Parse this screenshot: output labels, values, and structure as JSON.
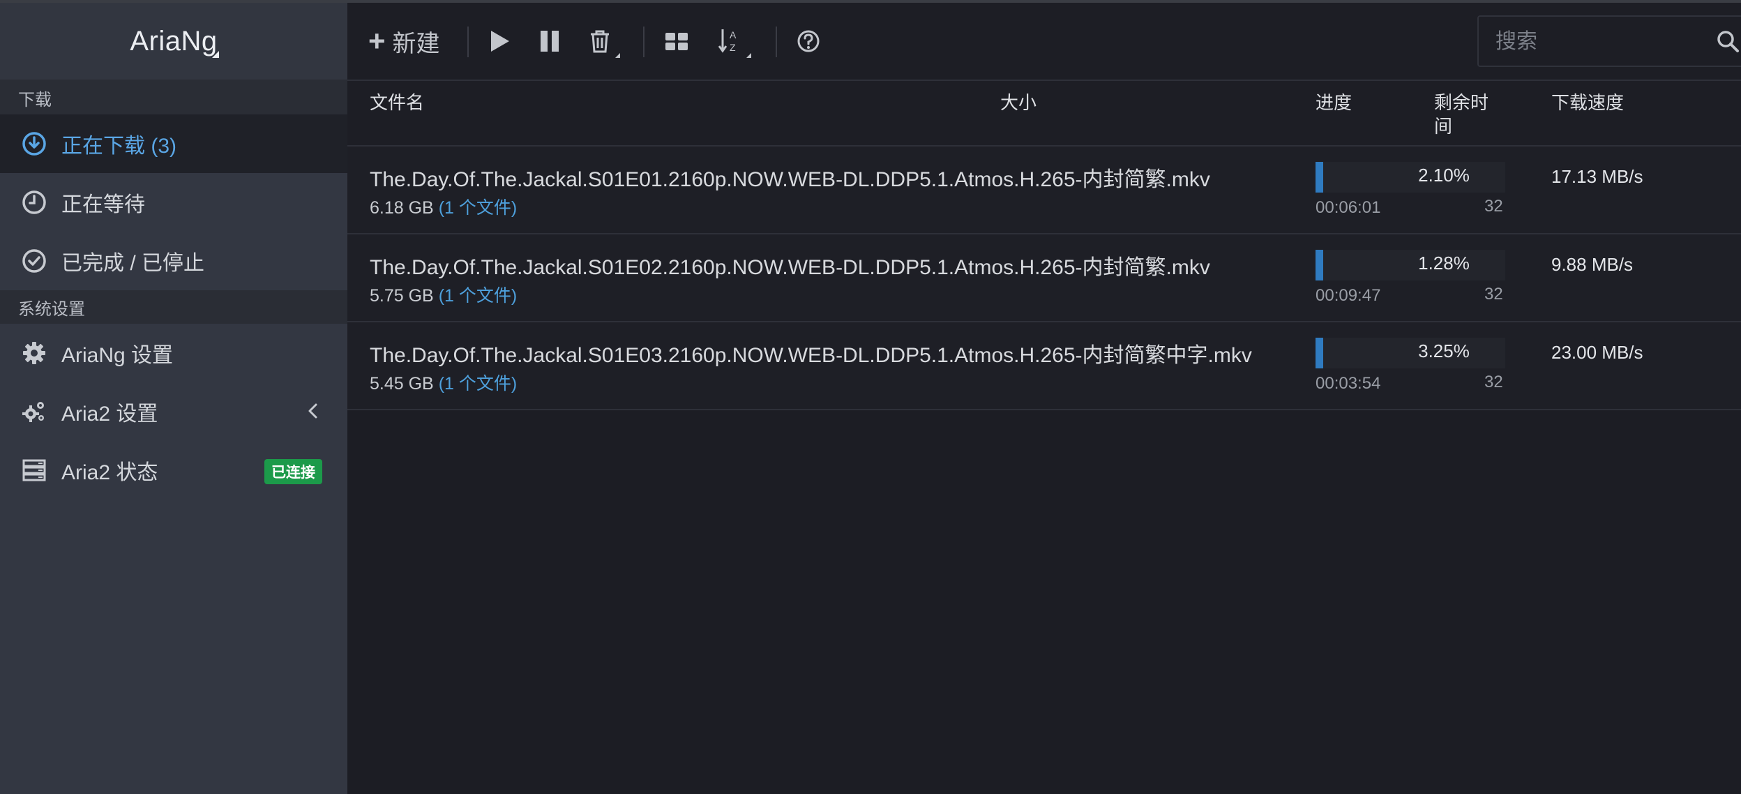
{
  "brand": {
    "name": "AriaNg"
  },
  "sidebar": {
    "download_header": "下载",
    "items": [
      {
        "label": "正在下载 (3)",
        "icon": "download-circle-icon",
        "active": true
      },
      {
        "label": "正在等待",
        "icon": "clock-icon"
      },
      {
        "label": "已完成 / 已停止",
        "icon": "check-circle-icon"
      }
    ],
    "settings_header": "系统设置",
    "settings_items": [
      {
        "label": "AriaNg 设置",
        "icon": "gear-icon"
      },
      {
        "label": "Aria2 设置",
        "icon": "gears-icon"
      },
      {
        "label": "Aria2 状态",
        "icon": "server-icon",
        "badge": "已连接"
      }
    ]
  },
  "toolbar": {
    "new_label": "新建",
    "search_placeholder": "搜索"
  },
  "table": {
    "headers": {
      "name": "文件名",
      "size": "大小",
      "progress": "进度",
      "remaining": "剩余时间",
      "speed": "下载速度"
    },
    "rows": [
      {
        "name": "The.Day.Of.The.Jackal.S01E01.2160p.NOW.WEB-DL.DDP5.1.Atmos.H.265-内封简繁.mkv",
        "size": "6.18 GB",
        "files": "(1 个文件)",
        "progress": 2.1,
        "progress_text": "2.10%",
        "eta": "00:06:01",
        "connections": "32",
        "speed": "17.13 MB/s"
      },
      {
        "name": "The.Day.Of.The.Jackal.S01E02.2160p.NOW.WEB-DL.DDP5.1.Atmos.H.265-内封简繁.mkv",
        "size": "5.75 GB",
        "files": "(1 个文件)",
        "progress": 1.28,
        "progress_text": "1.28%",
        "eta": "00:09:47",
        "connections": "32",
        "speed": "9.88 MB/s"
      },
      {
        "name": "The.Day.Of.The.Jackal.S01E03.2160p.NOW.WEB-DL.DDP5.1.Atmos.H.265-内封简繁中字.mkv",
        "size": "5.45 GB",
        "files": "(1 个文件)",
        "progress": 3.25,
        "progress_text": "3.25%",
        "eta": "00:03:54",
        "connections": "32",
        "speed": "23.00 MB/s"
      }
    ]
  },
  "colors": {
    "accent": "#5aa6e5",
    "badge": "#1c9a4a",
    "progress": "#2f7bc0"
  }
}
